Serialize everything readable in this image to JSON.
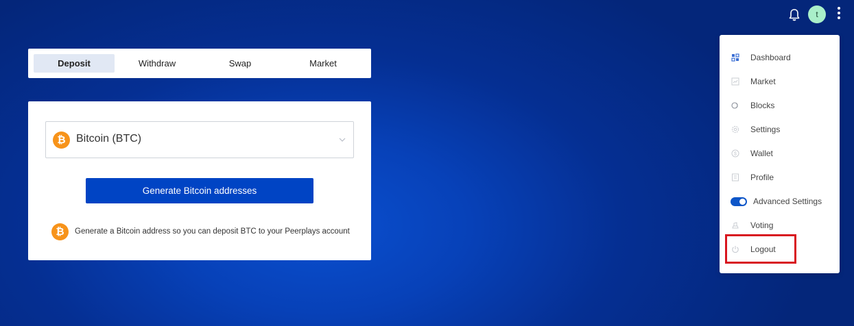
{
  "header": {
    "avatar_initial": "t"
  },
  "tabs": [
    {
      "label": "Deposit",
      "active": true
    },
    {
      "label": "Withdraw",
      "active": false
    },
    {
      "label": "Swap",
      "active": false
    },
    {
      "label": "Market",
      "active": false
    }
  ],
  "deposit": {
    "coin_selected": "Bitcoin (BTC)",
    "coin_logo_glyph": "₿",
    "generate_button_label": "Generate Bitcoin addresses",
    "info_text": "Generate a Bitcoin address so you can deposit BTC to your Peerplays account"
  },
  "menu": {
    "items": [
      {
        "label": "Dashboard",
        "icon": "dashboard-icon"
      },
      {
        "label": "Market",
        "icon": "market-icon"
      },
      {
        "label": "Blocks",
        "icon": "blocks-icon"
      },
      {
        "label": "Settings",
        "icon": "settings-icon"
      },
      {
        "label": "Wallet",
        "icon": "wallet-icon"
      },
      {
        "label": "Profile",
        "icon": "profile-icon"
      },
      {
        "label": "Advanced Settings",
        "icon": "toggle-switch",
        "toggle_on": true
      },
      {
        "label": "Voting",
        "icon": "voting-icon"
      },
      {
        "label": "Logout",
        "icon": "power-icon",
        "highlighted": true
      }
    ]
  },
  "colors": {
    "accent": "#0044c4",
    "bitcoin": "#f7931a",
    "highlight": "#d8151f",
    "avatar_bg": "#a9efc9"
  }
}
